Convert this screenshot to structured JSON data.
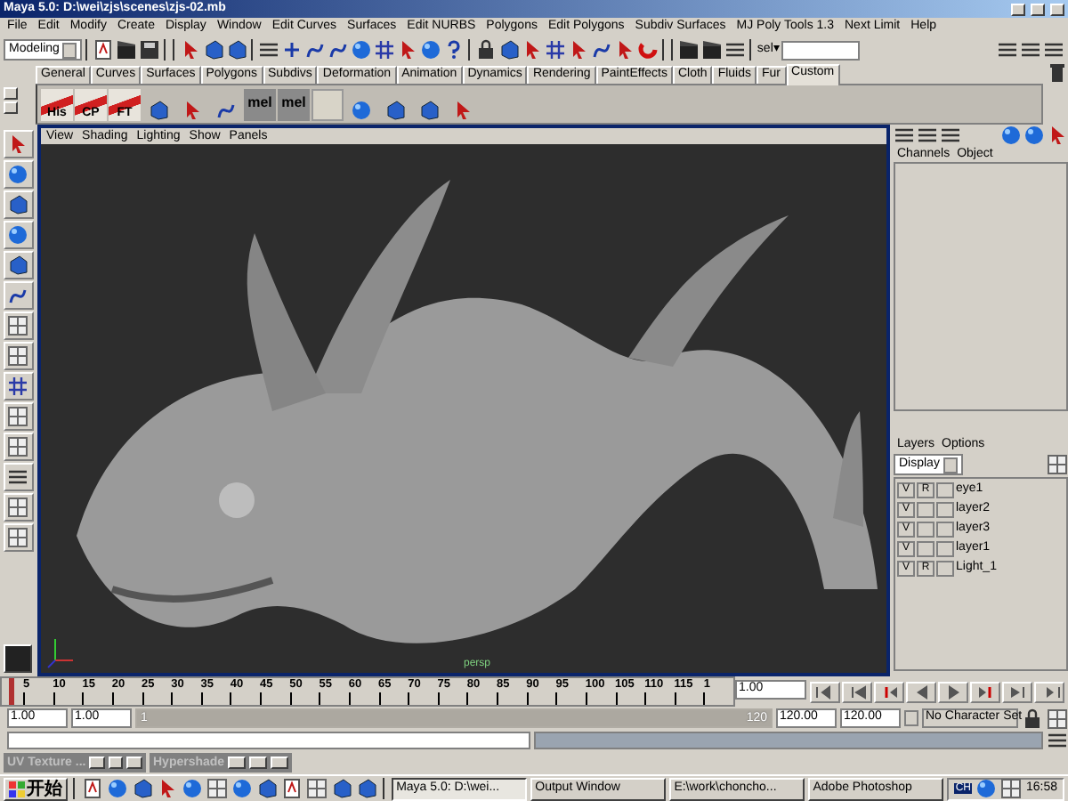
{
  "window": {
    "title": "Maya 5.0: D:\\wei\\zjs\\scenes\\zjs-02.mb"
  },
  "menu": [
    "File",
    "Edit",
    "Modify",
    "Create",
    "Display",
    "Window",
    "Edit Curves",
    "Surfaces",
    "Edit NURBS",
    "Polygons",
    "Edit Polygons",
    "Subdiv Surfaces",
    "MJ Poly Tools 1.3",
    "Next Limit",
    "Help"
  ],
  "status_line": {
    "mode": "Modeling",
    "sel_label": "sel▾"
  },
  "shelf_tabs": [
    {
      "label": "General",
      "selected": false
    },
    {
      "label": "Curves",
      "selected": false
    },
    {
      "label": "Surfaces",
      "selected": false
    },
    {
      "label": "Polygons",
      "selected": false
    },
    {
      "label": "Subdivs",
      "selected": false
    },
    {
      "label": "Deformation",
      "selected": false
    },
    {
      "label": "Animation",
      "selected": false
    },
    {
      "label": "Dynamics",
      "selected": false
    },
    {
      "label": "Rendering",
      "selected": false
    },
    {
      "label": "PaintEffects",
      "selected": false
    },
    {
      "label": "Cloth",
      "selected": false
    },
    {
      "label": "Fluids",
      "selected": false
    },
    {
      "label": "Fur",
      "selected": false
    },
    {
      "label": "Custom",
      "selected": true
    }
  ],
  "shelf": [
    {
      "kind": "labeled",
      "label": "His"
    },
    {
      "kind": "labeled",
      "label": "CP"
    },
    {
      "kind": "labeled",
      "label": "FT"
    },
    {
      "kind": "icon"
    },
    {
      "kind": "icon"
    },
    {
      "kind": "icon"
    },
    {
      "kind": "labeled",
      "label": "mel"
    },
    {
      "kind": "labeled",
      "label": "mel"
    },
    {
      "kind": "blank"
    },
    {
      "kind": "icon"
    },
    {
      "kind": "icon"
    },
    {
      "kind": "icon"
    },
    {
      "kind": "icon"
    }
  ],
  "viewport": {
    "menu": [
      "View",
      "Shading",
      "Lighting",
      "Show",
      "Panels"
    ],
    "camera": "persp"
  },
  "channel_box": {
    "menu": [
      "Channels",
      "Object"
    ]
  },
  "layers": {
    "menu": [
      "Layers",
      "Options"
    ],
    "mode": "Display",
    "rows": [
      {
        "name": "eye1",
        "visible": "V",
        "reference": "R"
      },
      {
        "name": "layer2",
        "visible": "V"
      },
      {
        "name": "layer3",
        "visible": "V"
      },
      {
        "name": "layer1",
        "visible": "V"
      },
      {
        "name": "Light_1",
        "visible": "V",
        "reference": "R"
      }
    ]
  },
  "time_slider": {
    "ticks": [
      "5",
      "10",
      "15",
      "20",
      "25",
      "30",
      "35",
      "40",
      "45",
      "50",
      "55",
      "60",
      "65",
      "70",
      "75",
      "80",
      "85",
      "90",
      "95",
      "100",
      "105",
      "110",
      "115",
      "1"
    ],
    "current_time": "1.00",
    "level": 0.01
  },
  "range_slider": {
    "start_time": "1.00",
    "range_start": "1.00",
    "slider_start": "1",
    "slider_end": "120",
    "level": 1,
    "range_end": "120.00",
    "end_time": "120.00",
    "character_set": "No Character Set"
  },
  "minimized_windows": [
    "UV Texture ...",
    "Hypershade"
  ],
  "taskbar": {
    "start": "开始",
    "tasks": [
      {
        "label": "Maya 5.0: D:\\wei...",
        "selected": true
      },
      {
        "label": "Output Window",
        "selected": false
      },
      {
        "label": "E:\\work\\chonchо...",
        "selected": false
      },
      {
        "label": "Adobe Photoshop",
        "selected": false
      }
    ],
    "input_indicator": "CH",
    "clock": "16:58"
  }
}
